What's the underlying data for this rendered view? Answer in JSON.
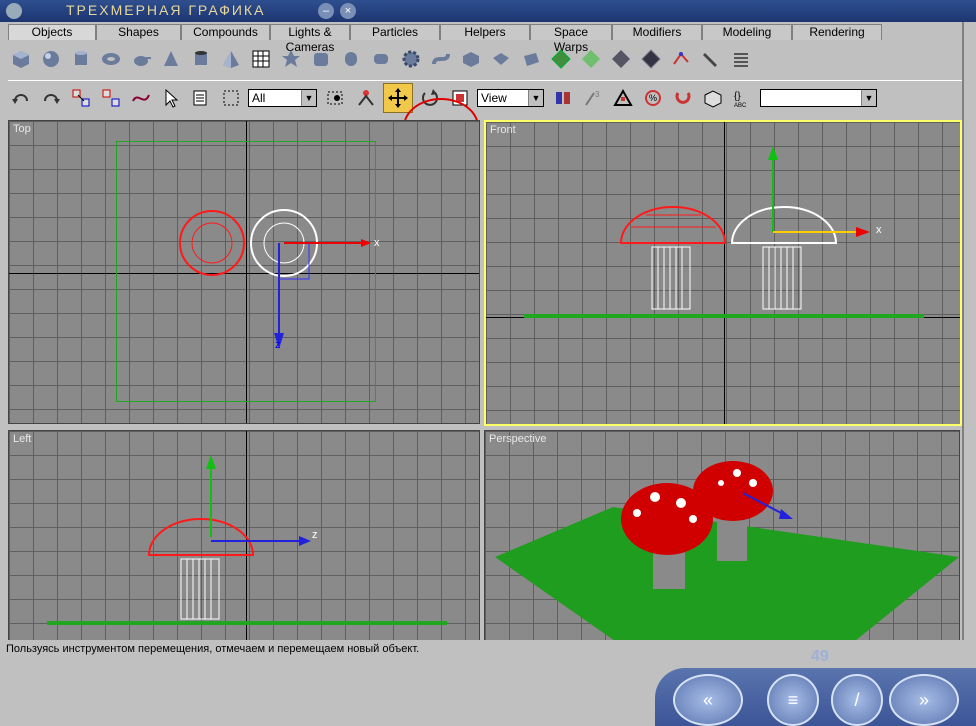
{
  "title": "ТРЕХМЕРНАЯ ГРАФИКА",
  "window_buttons": {
    "minimize": "–",
    "close": "×"
  },
  "tabs": [
    "Objects",
    "Shapes",
    "Compounds",
    "Lights & Cameras",
    "Particles",
    "Helpers",
    "Space Warps",
    "Modifiers",
    "Modeling",
    "Rendering"
  ],
  "toolbar": {
    "selection_filter": "All",
    "reference_coord": "View",
    "named_selection": ""
  },
  "viewports": {
    "top": "Top",
    "front": "Front",
    "left": "Left",
    "perspective": "Perspective"
  },
  "axis_labels": {
    "x": "x",
    "y": "y",
    "z": "z"
  },
  "status_text": "Пользуясь инструментом перемещения, отмечаем и перемещаем новый объект.",
  "page_number": "49",
  "colors": {
    "accent_red": "#e00000",
    "mushroom_cap": "#cc0000",
    "ground": "#1f9d1f",
    "active_border": "#ffff66"
  }
}
